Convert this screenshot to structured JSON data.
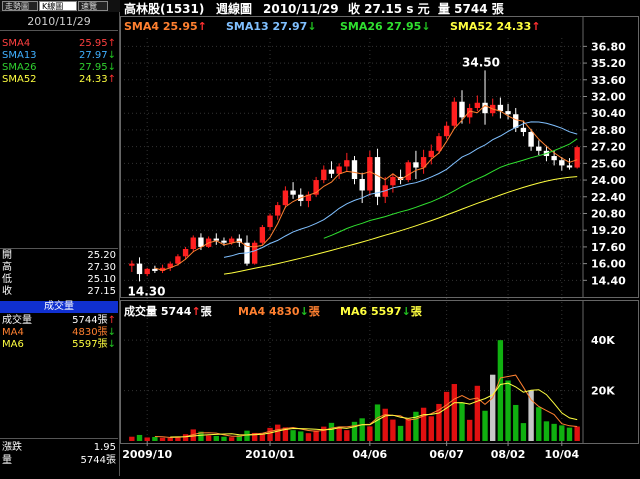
{
  "tabs": [
    "走勢圖",
    "K線圖",
    "速覽"
  ],
  "left": {
    "date": "2010/11/29",
    "sma": [
      {
        "label": "SMA4",
        "value": "25.95",
        "dir": "up",
        "color": "#ff4040"
      },
      {
        "label": "SMA13",
        "value": "27.97",
        "dir": "down",
        "color": "#40b0ff"
      },
      {
        "label": "SMA26",
        "value": "27.95",
        "dir": "down",
        "color": "#30d030"
      },
      {
        "label": "SMA52",
        "value": "24.33",
        "dir": "up",
        "color": "#ffff40"
      }
    ],
    "ohlc": [
      {
        "label": "開",
        "value": "25.20"
      },
      {
        "label": "高",
        "value": "27.30"
      },
      {
        "label": "低",
        "value": "25.10"
      },
      {
        "label": "收",
        "value": "27.15"
      }
    ],
    "vol_title": "成交量",
    "vol": [
      {
        "label": "成交量",
        "value": "5744張",
        "dir": "up",
        "color": "#ffffff"
      },
      {
        "label": "MA4",
        "value": "4830張",
        "dir": "down",
        "color": "#ff8030"
      },
      {
        "label": "MA6",
        "value": "5597張",
        "dir": "down",
        "color": "#ffff40"
      }
    ],
    "bottom": [
      {
        "label": "漲跌",
        "value": "1.95"
      },
      {
        "label": "量",
        "value": "5744張"
      }
    ]
  },
  "header": {
    "name": "高林股(1531)",
    "kind": "週線圖",
    "date": "2010/11/29",
    "close_label": "收",
    "close": "27.15",
    "close_unit": "s 元",
    "vol_label": "量",
    "vol": "5744",
    "vol_unit": "張"
  },
  "legend": [
    {
      "text": "SMA4 25.95",
      "dir": "up",
      "color": "#ff8030"
    },
    {
      "text": "SMA13 27.97",
      "dir": "down",
      "color": "#80c0ff"
    },
    {
      "text": "SMA26 27.95",
      "dir": "down",
      "color": "#30e030"
    },
    {
      "text": "SMA52 24.33",
      "dir": "up",
      "color": "#ffff40"
    }
  ],
  "vol_legend": [
    {
      "text": "成交量 5744",
      "dir": "up",
      "unit": "張",
      "color": "#ffffff"
    },
    {
      "text": "MA4 4830",
      "dir": "down",
      "unit": "張",
      "color": "#ff8030"
    },
    {
      "text": "MA6 5597",
      "dir": "down",
      "unit": "張",
      "color": "#ffff40"
    }
  ],
  "arrows": {
    "up": "↑",
    "down": "↓"
  },
  "colors": {
    "up": "#ff3030",
    "down": "#20c020"
  },
  "chart_data": {
    "type": "candlestick",
    "price_axis": {
      "ticks": [
        "36.80",
        "35.20",
        "33.60",
        "32.00",
        "30.40",
        "28.80",
        "27.20",
        "25.60",
        "24.00",
        "22.40",
        "20.80",
        "19.20",
        "17.60",
        "16.00",
        "14.40"
      ],
      "min": 12.9,
      "max": 37.6
    },
    "volume_axis": {
      "ticks": [
        "40K",
        "20K"
      ],
      "max": 48000
    },
    "x_labels": [
      "2009/10",
      "2010/01",
      "04/06",
      "06/07",
      "08/02",
      "10/04"
    ],
    "annotations": {
      "high": "34.50",
      "low": "14.30"
    },
    "candles": [
      {
        "o": 15.8,
        "h": 16.3,
        "l": 15.2,
        "c": 16.0
      },
      {
        "o": 16.0,
        "h": 16.6,
        "l": 14.3,
        "c": 15.0
      },
      {
        "o": 15.0,
        "h": 15.6,
        "l": 14.8,
        "c": 15.5
      },
      {
        "o": 15.5,
        "h": 15.8,
        "l": 15.1,
        "c": 15.3
      },
      {
        "o": 15.3,
        "h": 15.9,
        "l": 15.1,
        "c": 15.6
      },
      {
        "o": 15.6,
        "h": 16.2,
        "l": 15.3,
        "c": 16.0
      },
      {
        "o": 16.0,
        "h": 16.9,
        "l": 15.8,
        "c": 16.7
      },
      {
        "o": 16.7,
        "h": 17.6,
        "l": 16.4,
        "c": 17.4
      },
      {
        "o": 17.4,
        "h": 18.7,
        "l": 17.1,
        "c": 18.5
      },
      {
        "o": 18.5,
        "h": 18.9,
        "l": 17.3,
        "c": 17.6
      },
      {
        "o": 17.6,
        "h": 18.6,
        "l": 17.5,
        "c": 18.4
      },
      {
        "o": 18.4,
        "h": 18.9,
        "l": 17.8,
        "c": 18.2
      },
      {
        "o": 18.2,
        "h": 18.5,
        "l": 17.7,
        "c": 18.0
      },
      {
        "o": 18.0,
        "h": 18.6,
        "l": 17.8,
        "c": 18.4
      },
      {
        "o": 18.4,
        "h": 18.8,
        "l": 17.6,
        "c": 18.0
      },
      {
        "o": 18.0,
        "h": 18.7,
        "l": 15.8,
        "c": 16.0
      },
      {
        "o": 16.0,
        "h": 18.2,
        "l": 15.9,
        "c": 18.0
      },
      {
        "o": 18.0,
        "h": 19.7,
        "l": 17.8,
        "c": 19.5
      },
      {
        "o": 19.5,
        "h": 20.8,
        "l": 19.2,
        "c": 20.6
      },
      {
        "o": 20.6,
        "h": 21.9,
        "l": 20.2,
        "c": 21.6
      },
      {
        "o": 21.6,
        "h": 23.4,
        "l": 21.3,
        "c": 23.0
      },
      {
        "o": 23.0,
        "h": 23.8,
        "l": 22.2,
        "c": 22.6
      },
      {
        "o": 22.6,
        "h": 23.2,
        "l": 21.5,
        "c": 22.0
      },
      {
        "o": 22.0,
        "h": 22.9,
        "l": 21.4,
        "c": 22.6
      },
      {
        "o": 22.6,
        "h": 24.3,
        "l": 22.4,
        "c": 24.0
      },
      {
        "o": 24.0,
        "h": 25.4,
        "l": 23.7,
        "c": 25.0
      },
      {
        "o": 25.0,
        "h": 25.8,
        "l": 24.2,
        "c": 24.6
      },
      {
        "o": 24.6,
        "h": 25.6,
        "l": 24.1,
        "c": 25.3
      },
      {
        "o": 25.3,
        "h": 26.6,
        "l": 24.8,
        "c": 25.9
      },
      {
        "o": 25.9,
        "h": 26.3,
        "l": 23.6,
        "c": 24.1
      },
      {
        "o": 24.1,
        "h": 24.7,
        "l": 21.8,
        "c": 23.0
      },
      {
        "o": 23.0,
        "h": 26.8,
        "l": 22.5,
        "c": 26.2
      },
      {
        "o": 26.2,
        "h": 27.0,
        "l": 21.6,
        "c": 22.4
      },
      {
        "o": 22.4,
        "h": 24.3,
        "l": 21.8,
        "c": 23.5
      },
      {
        "o": 23.5,
        "h": 24.6,
        "l": 22.8,
        "c": 24.3
      },
      {
        "o": 24.3,
        "h": 25.0,
        "l": 23.6,
        "c": 24.0
      },
      {
        "o": 24.0,
        "h": 25.9,
        "l": 23.8,
        "c": 25.7
      },
      {
        "o": 25.7,
        "h": 26.8,
        "l": 24.1,
        "c": 25.2
      },
      {
        "o": 25.2,
        "h": 26.9,
        "l": 24.6,
        "c": 26.2
      },
      {
        "o": 26.2,
        "h": 27.4,
        "l": 25.5,
        "c": 26.8
      },
      {
        "o": 26.8,
        "h": 28.5,
        "l": 26.5,
        "c": 28.2
      },
      {
        "o": 28.2,
        "h": 29.6,
        "l": 27.9,
        "c": 29.2
      },
      {
        "o": 29.2,
        "h": 31.9,
        "l": 28.9,
        "c": 31.5
      },
      {
        "o": 31.5,
        "h": 32.6,
        "l": 29.4,
        "c": 30.0
      },
      {
        "o": 30.0,
        "h": 31.3,
        "l": 29.4,
        "c": 30.9
      },
      {
        "o": 30.9,
        "h": 32.1,
        "l": 30.6,
        "c": 31.4
      },
      {
        "o": 31.4,
        "h": 34.5,
        "l": 29.3,
        "c": 30.4
      },
      {
        "o": 30.4,
        "h": 31.8,
        "l": 30.1,
        "c": 31.2
      },
      {
        "o": 31.2,
        "h": 31.9,
        "l": 29.9,
        "c": 30.6
      },
      {
        "o": 30.6,
        "h": 31.3,
        "l": 29.8,
        "c": 30.3
      },
      {
        "o": 30.3,
        "h": 30.9,
        "l": 28.6,
        "c": 29.0
      },
      {
        "o": 29.0,
        "h": 29.7,
        "l": 28.2,
        "c": 28.6
      },
      {
        "o": 28.6,
        "h": 28.9,
        "l": 26.8,
        "c": 27.2
      },
      {
        "o": 27.2,
        "h": 27.8,
        "l": 26.4,
        "c": 26.8
      },
      {
        "o": 26.8,
        "h": 27.3,
        "l": 25.8,
        "c": 26.3
      },
      {
        "o": 26.3,
        "h": 26.8,
        "l": 25.4,
        "c": 25.9
      },
      {
        "o": 25.9,
        "h": 26.2,
        "l": 24.9,
        "c": 25.4
      },
      {
        "o": 25.4,
        "h": 26.1,
        "l": 25.0,
        "c": 25.2
      },
      {
        "o": 25.2,
        "h": 27.3,
        "l": 25.1,
        "c": 27.15
      }
    ],
    "volumes": [
      1700,
      2400,
      1400,
      1600,
      1300,
      1200,
      1800,
      2700,
      4600,
      3700,
      2200,
      2000,
      1700,
      1500,
      2300,
      4100,
      3200,
      2800,
      5200,
      6500,
      5400,
      4300,
      3800,
      3100,
      4200,
      5700,
      7200,
      5200,
      4300,
      7600,
      9000,
      5800,
      14500,
      12800,
      8500,
      6000,
      8800,
      11600,
      13200,
      9800,
      14700,
      19500,
      22600,
      15300,
      8400,
      21900,
      12000,
      26300,
      40000,
      24000,
      14300,
      7100,
      20000,
      13400,
      7800,
      6800,
      6200,
      5300,
      5744
    ],
    "series": [
      {
        "name": "SMA4",
        "values": [
          null,
          null,
          null,
          15.58,
          15.35,
          15.6,
          15.9,
          16.43,
          17.15,
          17.55,
          17.98,
          18.18,
          17.8,
          17.96,
          18.15,
          17.65,
          17.6,
          17.75,
          18.53,
          19.83,
          21.43,
          21.95,
          22.3,
          22.55,
          22.8,
          23.4,
          23.8,
          24.58,
          24.83,
          24.73,
          24.58,
          24.8,
          24.43,
          24.03,
          24.6,
          24.05,
          24.5,
          24.93,
          25.15,
          26.0,
          26.6,
          27.7,
          28.93,
          29.73,
          30.6,
          30.45,
          31.15,
          30.8,
          30.6,
          30.13,
          29.78,
          29.63,
          28.78,
          27.9,
          27.23,
          26.6,
          26.1,
          25.7,
          25.95
        ]
      },
      {
        "name": "SMA13",
        "values": [
          null,
          null,
          null,
          null,
          null,
          null,
          null,
          null,
          null,
          null,
          null,
          null,
          16.6,
          16.75,
          16.97,
          17.03,
          17.23,
          17.54,
          17.93,
          18.22,
          18.64,
          19.04,
          19.3,
          19.53,
          19.85,
          20.2,
          20.72,
          21.29,
          21.73,
          22.05,
          22.3,
          22.64,
          22.78,
          22.97,
          23.26,
          23.4,
          23.61,
          23.75,
          24.0,
          24.3,
          24.63,
          25.03,
          25.62,
          26.2,
          26.53,
          26.99,
          27.36,
          27.86,
          28.22,
          28.66,
          29.04,
          29.4,
          29.57,
          29.56,
          29.43,
          29.22,
          28.96,
          28.62,
          28.4
        ]
      },
      {
        "name": "SMA26",
        "values": [
          null,
          null,
          null,
          null,
          null,
          null,
          null,
          null,
          null,
          null,
          null,
          null,
          null,
          null,
          null,
          null,
          null,
          null,
          null,
          null,
          null,
          null,
          null,
          null,
          null,
          18.42,
          18.71,
          19.03,
          19.36,
          19.63,
          19.86,
          20.13,
          20.31,
          20.5,
          20.74,
          20.96,
          21.14,
          21.39,
          21.66,
          21.92,
          22.24,
          22.58,
          22.97,
          23.38,
          23.76,
          24.11,
          24.44,
          24.84,
          25.22,
          25.49,
          25.69,
          25.91,
          26.14,
          26.33,
          26.54,
          26.82,
          27.13,
          27.44,
          27.95
        ]
      },
      {
        "name": "SMA52",
        "values": [
          null,
          null,
          null,
          null,
          null,
          null,
          null,
          null,
          null,
          null,
          null,
          null,
          15.0,
          15.1,
          15.25,
          15.4,
          15.55,
          15.7,
          15.85,
          16.0,
          16.17,
          16.35,
          16.52,
          16.7,
          16.88,
          17.07,
          17.27,
          17.47,
          17.67,
          17.87,
          18.07,
          18.28,
          18.5,
          18.72,
          18.93,
          19.15,
          19.38,
          19.62,
          19.87,
          20.12,
          20.38,
          20.65,
          20.93,
          21.22,
          21.5,
          21.77,
          22.03,
          22.3,
          22.57,
          22.83,
          23.07,
          23.3,
          23.52,
          23.72,
          23.9,
          24.05,
          24.17,
          24.27,
          24.33
        ]
      },
      {
        "name": "MA4",
        "values": [
          null,
          null,
          null,
          1775,
          1675,
          1375,
          1475,
          1750,
          2575,
          3200,
          3275,
          3125,
          2400,
          1850,
          1875,
          2400,
          2775,
          3100,
          3825,
          4425,
          4975,
          5350,
          4750,
          4150,
          3850,
          4200,
          5100,
          5575,
          5600,
          6075,
          6525,
          6675,
          9200,
          10525,
          10150,
          9950,
          8275,
          8725,
          9900,
          10850,
          12325,
          14300,
          16650,
          18000,
          16450,
          17050,
          14525,
          17150,
          25050,
          25575,
          26150,
          21350,
          16350,
          13700,
          12075,
          10500,
          6850,
          6025,
          5744
        ]
      },
      {
        "name": "MA6",
        "values": [
          null,
          null,
          null,
          null,
          null,
          1600,
          1617,
          1650,
          2000,
          2300,
          2483,
          2617,
          2767,
          2850,
          2500,
          2367,
          2483,
          2683,
          3183,
          3933,
          4567,
          4967,
          4900,
          4800,
          4667,
          4417,
          4617,
          5250,
          5017,
          5650,
          6467,
          6483,
          8267,
          9950,
          10233,
          9433,
          8967,
          9450,
          10483,
          10567,
          11100,
          13033,
          15200,
          15250,
          14650,
          15800,
          16817,
          18333,
          22400,
          22983,
          21450,
          19350,
          20117,
          20367,
          18400,
          14933,
          11133,
          9167,
          8473
        ]
      }
    ]
  }
}
